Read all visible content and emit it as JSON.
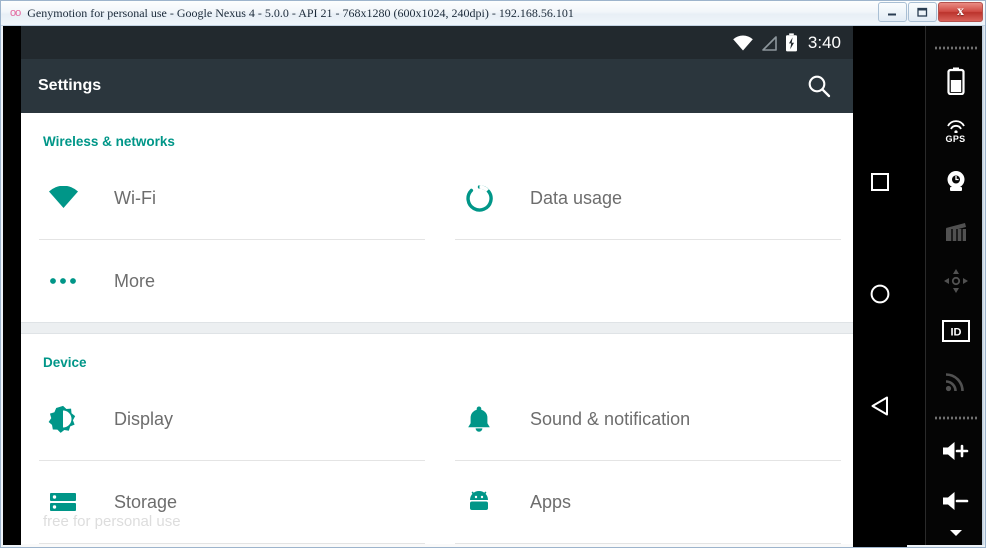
{
  "window": {
    "logo": "oo",
    "title": "Genymotion for personal use - Google Nexus 4 - 5.0.0 - API 21 - 768x1280 (600x1024, 240dpi) - 192.168.56.101",
    "buttons": {
      "minimize": "minimize-button",
      "maximize": "maximize-button",
      "close_glyph": "x"
    }
  },
  "android": {
    "status_bar": {
      "time": "3:40",
      "icons": [
        "wifi-icon",
        "cell-signal-icon",
        "battery-charging-icon"
      ],
      "background": "#22292e"
    },
    "action_bar": {
      "title": "Settings",
      "search_icon": "search-icon",
      "background": "#2b363d"
    },
    "accent_color": "#009688",
    "sections": [
      {
        "title": "Wireless & networks",
        "rows": [
          [
            {
              "icon": "wifi-icon",
              "label": "Wi-Fi"
            },
            {
              "icon": "data-usage-icon",
              "label": "Data usage"
            }
          ],
          [
            {
              "icon": "more-dots-icon",
              "label": "More"
            },
            {
              "icon": "",
              "label": ""
            }
          ]
        ]
      },
      {
        "title": "Device",
        "rows": [
          [
            {
              "icon": "brightness-icon",
              "label": "Display"
            },
            {
              "icon": "bell-icon",
              "label": "Sound & notification"
            }
          ],
          [
            {
              "icon": "storage-icon",
              "label": "Storage"
            },
            {
              "icon": "android-robot-icon",
              "label": "Apps"
            }
          ]
        ]
      }
    ],
    "watermark": "free for personal use",
    "nav_buttons": [
      {
        "name": "recents-button",
        "glyph": "square"
      },
      {
        "name": "home-button",
        "glyph": "circle"
      },
      {
        "name": "back-button",
        "glyph": "triangle"
      }
    ]
  },
  "toolbar": {
    "items": [
      {
        "name": "battery-widget-button",
        "label": ""
      },
      {
        "name": "gps-widget-button",
        "label": "GPS"
      },
      {
        "name": "camera-widget-button",
        "label": ""
      },
      {
        "name": "video-recording-button",
        "label": ""
      },
      {
        "name": "rotation-widget-button",
        "label": ""
      },
      {
        "name": "identifiers-widget-button",
        "label": "ID"
      },
      {
        "name": "network-widget-button",
        "label": ""
      },
      {
        "name": "volume-up-button",
        "label": ""
      },
      {
        "name": "volume-down-button",
        "label": ""
      }
    ],
    "collapse": "chevron-down-icon"
  }
}
